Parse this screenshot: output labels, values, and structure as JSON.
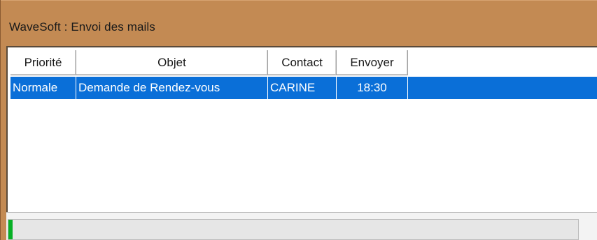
{
  "window": {
    "title": "WaveSoft : Envoi des mails"
  },
  "list": {
    "columns": [
      {
        "label": "Priorité"
      },
      {
        "label": "Objet"
      },
      {
        "label": "Contact"
      },
      {
        "label": "Envoyer"
      }
    ],
    "rows": [
      {
        "priority": "Normale",
        "subject": "Demande de Rendez-vous",
        "contact": "CARINE",
        "send_time": "18:30",
        "selected": true
      }
    ]
  },
  "progress": {
    "fraction": 0.0,
    "label": ""
  },
  "colors": {
    "titlebar": "#c38a53",
    "selection": "#0a6fd8",
    "progress_fill": "#06b025"
  }
}
